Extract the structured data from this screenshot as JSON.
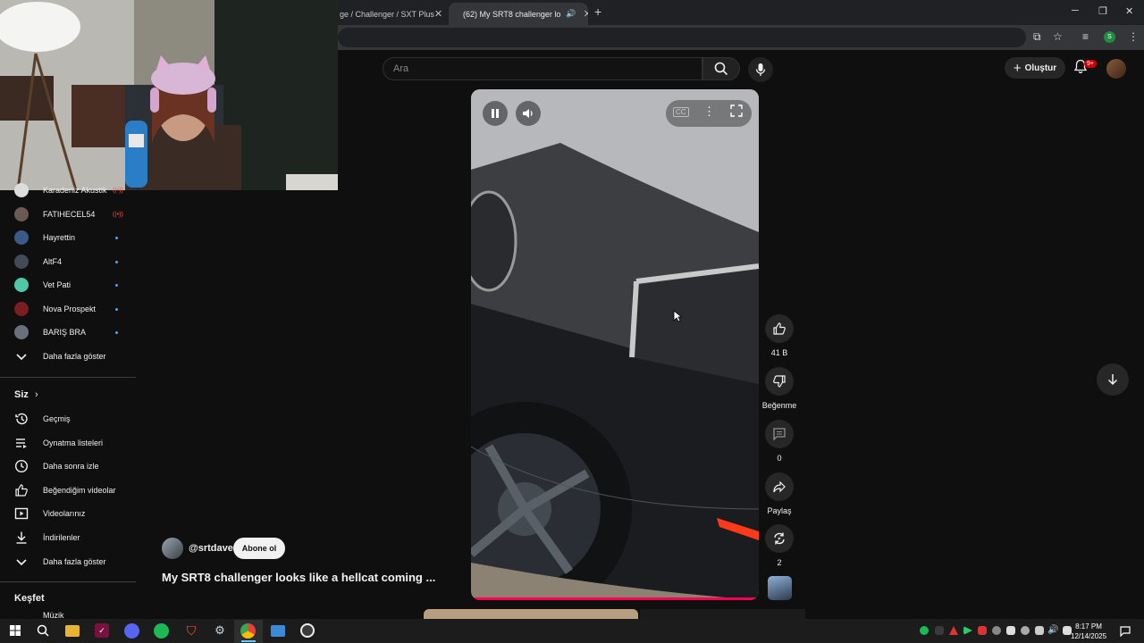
{
  "browser": {
    "tabs": [
      {
        "label": "ge / Challenger / SXT Plus"
      },
      {
        "label": "(62) My SRT8 challenger lo"
      }
    ],
    "profile_initial": "S"
  },
  "youtube": {
    "search_placeholder": "Ara",
    "create_label": "Oluştur",
    "notif_count": "9+"
  },
  "sidebar": {
    "subscriptions": [
      {
        "name": "Karadeniz Akustik",
        "status": "live"
      },
      {
        "name": "FATIHECEL54",
        "status": "live"
      },
      {
        "name": "Hayrettin",
        "status": "new"
      },
      {
        "name": "AltF4",
        "status": "new"
      },
      {
        "name": "Vet Pati",
        "status": "new"
      },
      {
        "name": "Nova Prospekt",
        "status": "new"
      },
      {
        "name": "BARIŞ BRA",
        "status": "new"
      }
    ],
    "show_more": "Daha fazla göster",
    "you_header": "Siz",
    "you_items": [
      {
        "label": "Geçmiş",
        "icon": "history-icon"
      },
      {
        "label": "Oynatma listeleri",
        "icon": "playlists-icon"
      },
      {
        "label": "Daha sonra izle",
        "icon": "clock-icon"
      },
      {
        "label": "Beğendiğim videolar",
        "icon": "thumb-up-icon"
      },
      {
        "label": "Videolarınız",
        "icon": "your-videos-icon"
      },
      {
        "label": "İndirilenler",
        "icon": "download-icon"
      }
    ],
    "show_more_2": "Daha fazla göster",
    "explore_header": "Keşfet",
    "explore_first": "Müzik"
  },
  "short": {
    "channel": "@srtdave",
    "subscribe_label": "Abone ol",
    "title": "My SRT8 challenger looks like a hellcat coming ...",
    "likes": "41 B",
    "dislike_label": "Beğenme",
    "comments": "0",
    "share_label": "Paylaş",
    "remix_count": "2"
  },
  "taskbar": {
    "time": "8:17 PM",
    "date": "12/14/2025"
  }
}
